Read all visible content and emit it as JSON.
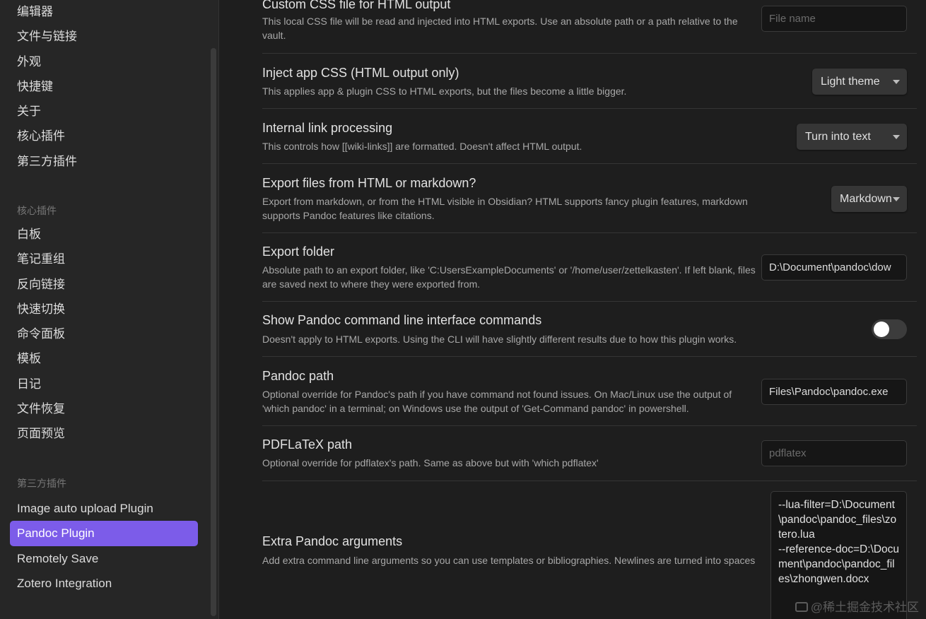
{
  "sidebar": {
    "options_items": [
      "编辑器",
      "文件与链接",
      "外观",
      "快捷键",
      "关于",
      "核心插件",
      "第三方插件"
    ],
    "core_heading": "核心插件",
    "core_items": [
      "白板",
      "笔记重组",
      "反向链接",
      "快速切换",
      "命令面板",
      "模板",
      "日记",
      "文件恢复",
      "页面预览"
    ],
    "community_heading": "第三方插件",
    "community_items": [
      "Image auto upload Plugin",
      "Pandoc Plugin",
      "Remotely Save",
      "Zotero Integration"
    ],
    "active_item": "Pandoc Plugin"
  },
  "settings": {
    "custom_css": {
      "name": "Custom CSS file for HTML output",
      "desc": "This local CSS file will be read and injected into HTML exports. Use an absolute path or a path relative to the vault.",
      "placeholder": "File name"
    },
    "inject_css": {
      "name": "Inject app CSS (HTML output only)",
      "desc": "This applies app & plugin CSS to HTML exports, but the files become a little bigger.",
      "value": "Light theme"
    },
    "link_processing": {
      "name": "Internal link processing",
      "desc": "This controls how [[wiki-links]] are formatted. Doesn't affect HTML output.",
      "value": "Turn into text"
    },
    "export_from": {
      "name": "Export files from HTML or markdown?",
      "desc": "Export from markdown, or from the HTML visible in Obsidian? HTML supports fancy plugin features, markdown supports Pandoc features like citations.",
      "value": "Markdown"
    },
    "export_folder": {
      "name": "Export folder",
      "desc": "Absolute path to an export folder, like 'C:UsersExampleDocuments' or '/home/user/zettelkasten'. If left blank, files are saved next to where they were exported from.",
      "value": "D:\\Document\\pandoc\\dow"
    },
    "show_cli": {
      "name": "Show Pandoc command line interface commands",
      "desc": "Doesn't apply to HTML exports. Using the CLI will have slightly different results due to how this plugin works.",
      "enabled": false
    },
    "pandoc_path": {
      "name": "Pandoc path",
      "desc": "Optional override for Pandoc's path if you have command not found issues. On Mac/Linux use the output of 'which pandoc' in a terminal; on Windows use the output of 'Get-Command pandoc' in powershell.",
      "value": "Files\\Pandoc\\pandoc.exe"
    },
    "pdflatex_path": {
      "name": "PDFLaTeX path",
      "desc": "Optional override for pdflatex's path. Same as above but with 'which pdflatex'",
      "placeholder": "pdflatex"
    },
    "extra_args": {
      "name": "Extra Pandoc arguments",
      "desc": "Add extra command line arguments so you can use templates or bibliographies. Newlines are turned into spaces",
      "value": "--lua-filter=D:\\Document\\pandoc\\pandoc_files\\zotero.lua\n--reference-doc=D:\\Document\\pandoc\\pandoc_files\\zhongwen.docx"
    }
  },
  "watermark": "@稀土掘金技术社区",
  "colors": {
    "accent": "#7c5ce9",
    "background": "#1e1e1e",
    "sidebar": "#262626"
  }
}
